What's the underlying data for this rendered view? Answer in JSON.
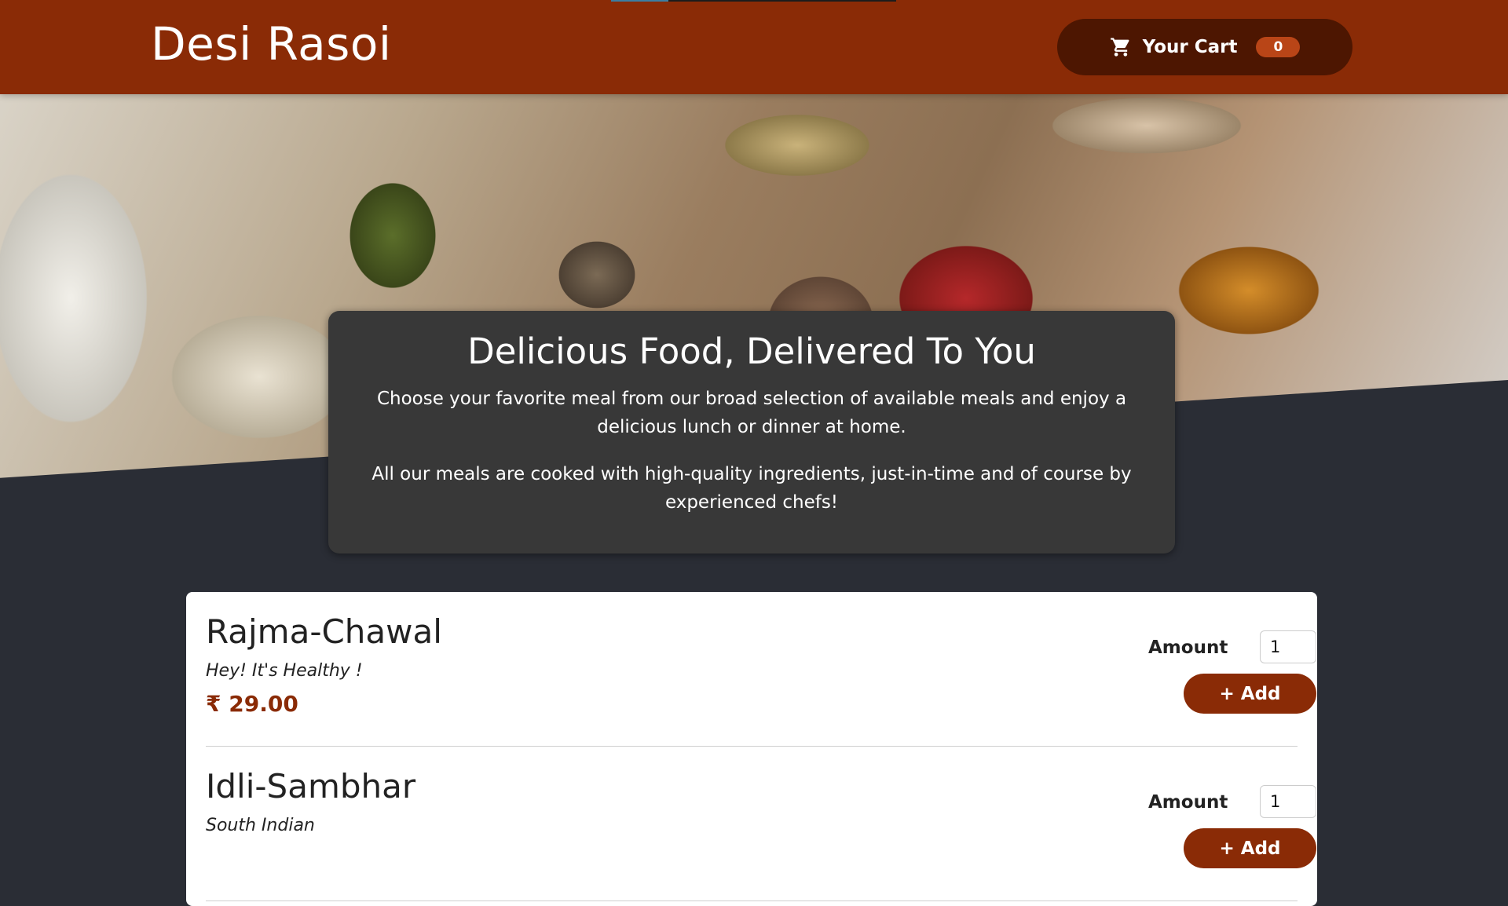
{
  "header": {
    "brand": "Desi Rasoi",
    "cart_label": "Your Cart",
    "cart_count": "0",
    "cart_icon": "shopping-cart-icon"
  },
  "intro": {
    "title": "Delicious Food, Delivered To You",
    "paragraph1": "Choose your favorite meal from our broad selection of available meals and enjoy a delicious lunch or dinner at home.",
    "paragraph2": "All our meals are cooked with high-quality ingredients, just-in-time and of course by experienced chefs!"
  },
  "meals": [
    {
      "name": "Rajma-Chawal",
      "description": "Hey! It's Healthy !",
      "price": "₹ 29.00",
      "amount_label": "Amount",
      "amount_value": "1",
      "add_label": "+ Add"
    },
    {
      "name": "Idli-Sambhar",
      "description": "South Indian",
      "price": "",
      "amount_label": "Amount",
      "amount_value": "1",
      "add_label": "+ Add"
    }
  ],
  "colors": {
    "header_bg": "#8a2b06",
    "cart_button_bg": "#4d1601",
    "badge_bg": "#b94517",
    "page_bg": "#2a2d35",
    "intro_card_bg": "#383838",
    "accent": "#8a2b06"
  }
}
